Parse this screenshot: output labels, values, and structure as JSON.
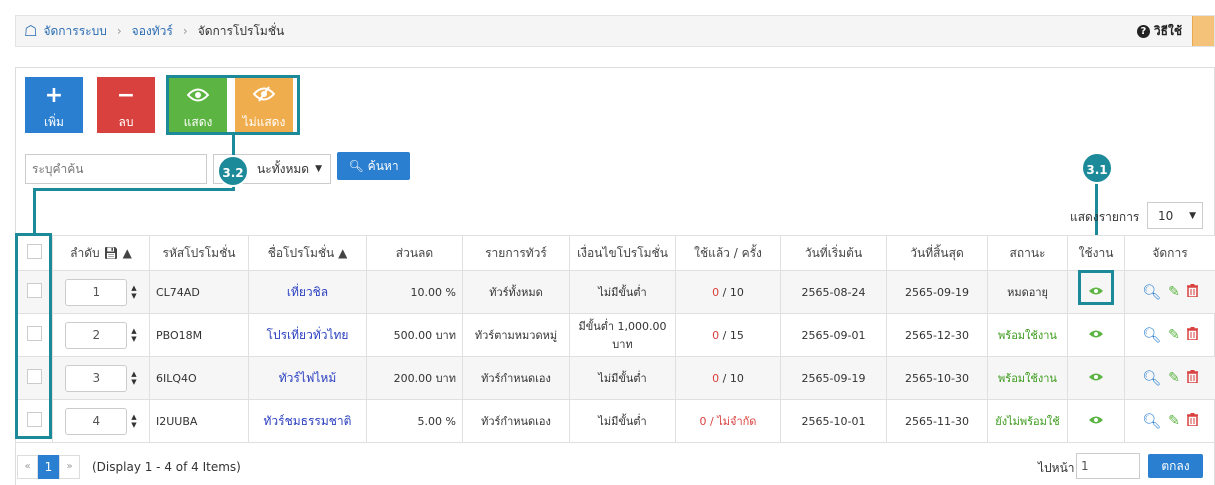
{
  "breadcrumb": {
    "items": [
      "จัดการระบบ",
      "จองทัวร์",
      "จัดการโปรโมชั่น"
    ]
  },
  "help": {
    "label": "วิธีใช้"
  },
  "toolbar": {
    "add": "เพิ่ม",
    "delete": "ลบ",
    "show": "แสดง",
    "hide": "ไม่แสดง"
  },
  "search": {
    "placeholder": "ระบุคำค้น",
    "status_value": "นะทั้งหมด",
    "button": "ค้นหา"
  },
  "annotations": {
    "a1": "3.1",
    "a2": "3.2"
  },
  "per_page": {
    "label": "แสดงรายการ",
    "value": "10"
  },
  "table": {
    "headers": [
      "ลำดับ",
      "รหัสโปรโมชั่น",
      "ชื่อโปรโมชั่น",
      "ส่วนลด",
      "รายการทัวร์",
      "เงื่อนไขโปรโมชั่น",
      "ใช้แล้ว / ครั้ง",
      "วันที่เริ่มต้น",
      "วันที่สิ้นสุด",
      "สถานะ",
      "ใช้งาน",
      "จัดการ"
    ],
    "rows": [
      {
        "order": "1",
        "code": "CL74AD",
        "name": "เที่ยวชิล",
        "discount": "10.00 %",
        "tours": "ทัวร์ทั้งหมด",
        "condition": "ไม่มีขั้นต่ำ",
        "used": "0",
        "limit": " / 10",
        "start": "2565-08-24",
        "end": "2565-09-19",
        "status": "หมดอายุ"
      },
      {
        "order": "2",
        "code": "PBO18M",
        "name": "โปรเที่ยวทั่วไทย",
        "discount": "500.00 บาท",
        "tours": "ทัวร์ตามหมวดหมู่",
        "condition": "มีขั้นต่ำ 1,000.00 บาท",
        "used": "0",
        "limit": " / 15",
        "start": "2565-09-01",
        "end": "2565-12-30",
        "status": "พร้อมใช้งาน"
      },
      {
        "order": "3",
        "code": "6ILQ4O",
        "name": "ทัวร์ไฟไหม้",
        "discount": "200.00 บาท",
        "tours": "ทัวร์กำหนดเอง",
        "condition": "ไม่มีขั้นต่ำ",
        "used": "0",
        "limit": " / 10",
        "start": "2565-09-19",
        "end": "2565-10-30",
        "status": "พร้อมใช้งาน"
      },
      {
        "order": "4",
        "code": "I2UUBA",
        "name": "ทัวร์ชมธรรมชาติ",
        "discount": "5.00 %",
        "tours": "ทัวร์กำหนดเอง",
        "condition": "ไม่มีขั้นต่ำ",
        "used": "0 / ไม่จำกัด",
        "limit": "",
        "start": "2565-10-01",
        "end": "2565-11-30",
        "status": "ยังไม่พร้อมใช้"
      }
    ]
  },
  "pager": {
    "prev": "«",
    "page": "1",
    "next": "»",
    "info": "(Display 1 - 4 of 4 Items)",
    "goto_label": "ไปหน้า :",
    "goto_value": "1",
    "goto_button": "ตกลง"
  },
  "colors": {
    "primary": "#2a7fd0",
    "danger": "#d9413e",
    "success": "#5cb442",
    "warning": "#f0ad4e",
    "annotation": "#1d8a99"
  }
}
